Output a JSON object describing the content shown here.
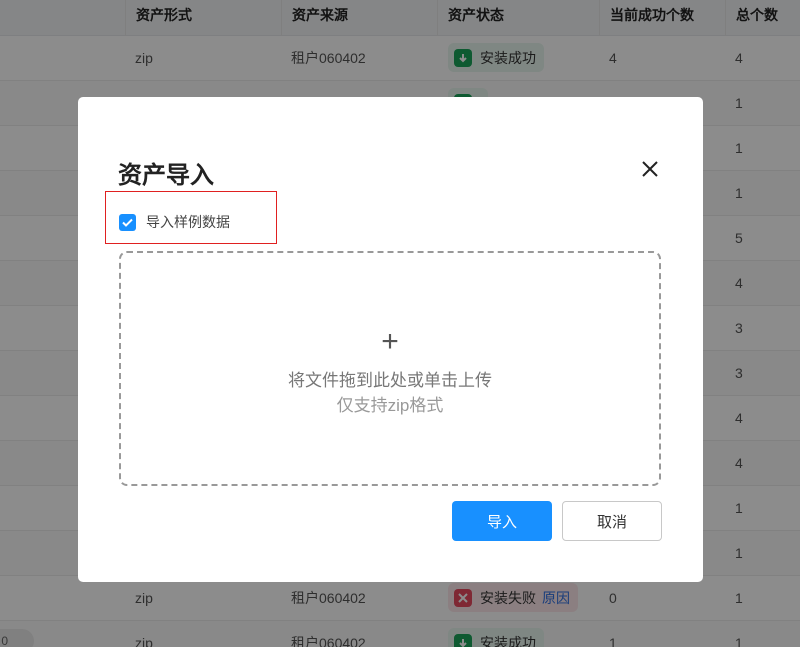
{
  "table": {
    "headers": [
      {
        "key": "form",
        "label": "资产形式"
      },
      {
        "key": "source",
        "label": "资产来源"
      },
      {
        "key": "status",
        "label": "资产状态"
      },
      {
        "key": "success",
        "label": "当前成功个数"
      },
      {
        "key": "total",
        "label": "总个数"
      }
    ],
    "rows": [
      {
        "form": "zip",
        "source": "租户060402",
        "status": "安装成功",
        "status_type": "success",
        "success": "4",
        "total": "4"
      },
      {
        "form": "",
        "source": "",
        "status": "",
        "status_type": "success",
        "success": "",
        "total": "1"
      },
      {
        "form": "",
        "source": "",
        "status": "",
        "status_type": "",
        "success": "",
        "total": "1"
      },
      {
        "form": "",
        "source": "",
        "status": "",
        "status_type": "",
        "success": "",
        "total": "1"
      },
      {
        "form": "",
        "source": "",
        "status": "",
        "status_type": "",
        "success": "",
        "total": "5"
      },
      {
        "form": "",
        "source": "",
        "status": "",
        "status_type": "",
        "success": "",
        "total": "4"
      },
      {
        "form": "",
        "source": "",
        "status": "",
        "status_type": "",
        "success": "",
        "total": "3"
      },
      {
        "form": "",
        "source": "",
        "status": "",
        "status_type": "",
        "success": "",
        "total": "3"
      },
      {
        "form": "",
        "source": "",
        "status": "",
        "status_type": "",
        "success": "",
        "total": "4"
      },
      {
        "form": "",
        "source": "",
        "status": "",
        "status_type": "",
        "success": "",
        "total": "4"
      },
      {
        "form": "",
        "source": "",
        "status": "",
        "status_type": "",
        "success": "",
        "total": "1"
      },
      {
        "form": "",
        "source": "",
        "status": "",
        "status_type": "",
        "success": "",
        "total": "1"
      },
      {
        "form": "zip",
        "source": "租户060402",
        "status": "安装失败",
        "status_type": "fail",
        "reason": "原因",
        "success": "0",
        "total": "1"
      },
      {
        "form": "zip",
        "source": "租户060402",
        "status": "安装成功",
        "status_type": "success",
        "success": "1",
        "total": "1"
      }
    ],
    "pill_text": "0"
  },
  "modal": {
    "title": "资产导入",
    "checkbox_label": "导入样例数据",
    "checkbox_checked": true,
    "upload_plus": "+",
    "upload_hint": "将文件拖到此处或单击上传",
    "upload_format": "仅支持zip格式",
    "import_button": "导入",
    "cancel_button": "取消"
  },
  "colors": {
    "primary": "#1890ff",
    "success": "#1aa55a",
    "fail": "#e84a5f",
    "highlight_border": "#e02020"
  }
}
